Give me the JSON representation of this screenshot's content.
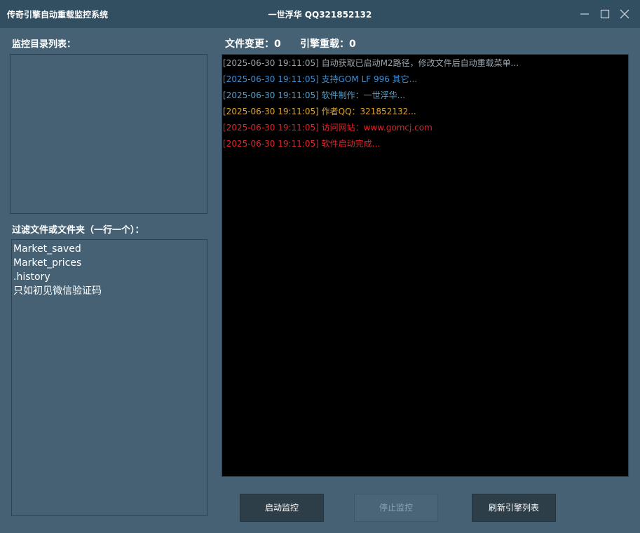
{
  "window": {
    "app_title": "传奇引擎自动重载监控系统",
    "center_title": "一世浮华 QQ321852132",
    "minimize_icon": "minimize-icon",
    "maximize_icon": "maximize-icon",
    "close_icon": "close-icon"
  },
  "left": {
    "monitor_dirs_label": "监控目录列表：",
    "monitor_dirs": [],
    "filter_label": "过滤文件或文件夹（一行一个）：",
    "filters": [
      "Market_saved",
      "Market_prices",
      ".history",
      "只如初见微信验证码"
    ]
  },
  "stats": {
    "file_change_label": "文件变更：",
    "file_change_count": "0",
    "engine_reload_label": "引擎重载：",
    "engine_reload_count": "0"
  },
  "log": {
    "lines": [
      {
        "text": "[2025-06-30 19:11:05] 自动获取已启动M2路径，修改文件后自动重载菜单...",
        "color": "#9aa4ac"
      },
      {
        "text": "[2025-06-30 19:11:05] 支持GOM LF 996 其它...",
        "color": "#3d8fd6"
      },
      {
        "text": "[2025-06-30 19:11:05] 软件制作：一世浮华...",
        "color": "#5aa0c8"
      },
      {
        "text": "[2025-06-30 19:11:05] 作者QQ：321852132...",
        "color": "#e0a52a"
      },
      {
        "text": "[2025-06-30 19:11:05] 访问网站：www.gomcj.com",
        "color": "#d8262b"
      },
      {
        "text": "[2025-06-30 19:11:05] 软件启动完成...",
        "color": "#e0262b"
      }
    ]
  },
  "buttons": {
    "start_label": "启动监控",
    "stop_label": "停止监控",
    "refresh_label": "刷新引擎列表"
  }
}
